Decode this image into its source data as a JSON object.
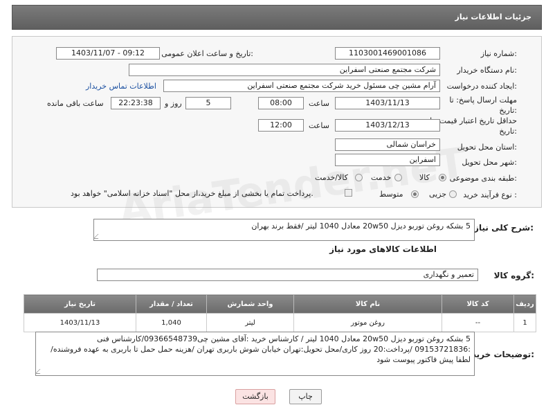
{
  "header": {
    "title": "جزئیات اطلاعات نیاز"
  },
  "fields": {
    "need_number_label": "شماره نیاز:",
    "need_number": "1103001469001086",
    "announce_label": "تاریخ و ساعت اعلان عمومی:",
    "announce_value": "1403/11/07 - 09:12",
    "buyer_org_label": "نام دستگاه خریدار:",
    "buyer_org": "شرکت مجتمع صنعتی اسفراین",
    "requester_label": "ایجاد کننده درخواست:",
    "requester": "آرام مشین چی مسئول خرید شرکت مجتمع صنعتی اسفراین",
    "contact_link": "اطلاعات تماس خریدار",
    "deadline_label": "مهلت ارسال پاسخ: تا تاریخ:",
    "deadline_date": "1403/11/13",
    "time_label": "ساعت",
    "deadline_time": "08:00",
    "days_value": "5",
    "days_label": "روز و",
    "remaining_time": "22:23:38",
    "remaining_label": "ساعت باقی مانده",
    "validity_label": "حداقل تاریخ اعتبار قیمت: تا تاریخ:",
    "validity_date": "1403/12/13",
    "validity_time": "12:00",
    "province_label": "استان محل تحویل:",
    "province": "خراسان شمالی",
    "city_label": "شهر محل تحویل:",
    "city": "اسفراین",
    "category_label": "طبقه بندی موضوعی:",
    "cat_goods": "کالا",
    "cat_service": "خدمت",
    "cat_goods_service": "کالا/خدمت",
    "process_label": "نوع فرآیند خرید :",
    "proc_partial": "جزیی",
    "proc_medium": "متوسط",
    "treasury_note": "پرداخت تمام یا بخشی از مبلغ خرید،از محل \"اسناد خزانه اسلامی\" خواهد بود."
  },
  "summary": {
    "label": "شرح کلی نیاز:",
    "value": "5 بشکه روغن توربو دیزل 20w50 معادل 1040 لیتر /فقط برند بهران"
  },
  "goods_info_title": "اطلاعات کالاهای مورد نیاز",
  "goods_group": {
    "label": "گروه کالا:",
    "value": "تعمیر و نگهداری"
  },
  "table": {
    "headers": [
      "ردیف",
      "کد کالا",
      "نام کالا",
      "واحد شمارش",
      "تعداد / مقدار",
      "تاریخ نیاز"
    ],
    "rows": [
      [
        "1",
        "--",
        "روغن موتور",
        "لیتر",
        "1,040",
        "1403/11/13"
      ]
    ]
  },
  "buyer_notes": {
    "label": "توضیحات خریدار:",
    "value": "5 بشکه روغن توربو دیزل 20w50 معادل 1040 لیتر / کارشناس خرید :آقای مشین چی09366548739/کارشناس فنی :09153721836 /پرداخت:20 روز کاری/محل تحویل:تهران خیابان شوش باربری تهران /هزینه حمل حمل تا باربری به عهده فروشنده/لطفا پیش فاکتور پیوست شود"
  },
  "buttons": {
    "print": "چاپ",
    "back": "بازگشت"
  },
  "watermark": "AriaTender.neT",
  "colors": {
    "header_bg": "#6b6b6b",
    "link": "#1a4fa0",
    "back_button_bg": "#fbe3e3"
  }
}
